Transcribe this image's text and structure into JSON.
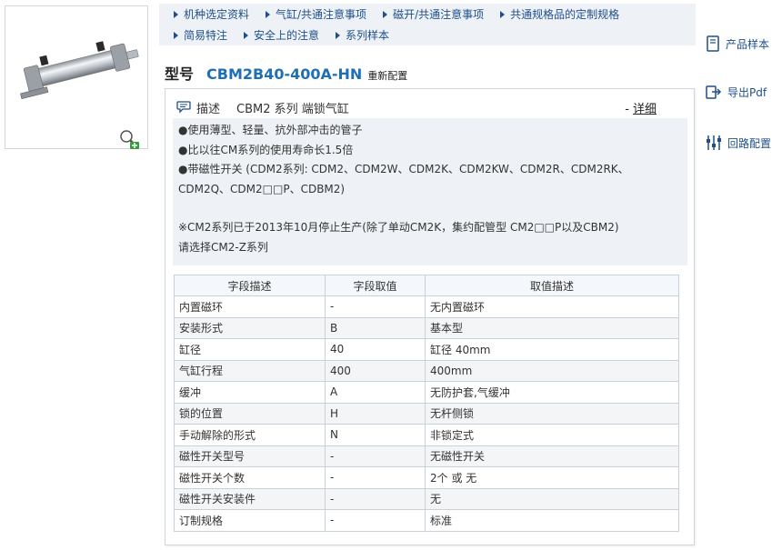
{
  "nav": {
    "row1": [
      "机种选定资料",
      "气缸/共通注意事项",
      "磁开/共通注意事项",
      "共通规格品的定制规格"
    ],
    "row2": [
      "简易特注",
      "安全上的注意",
      "系列样本"
    ]
  },
  "model": {
    "label": "型号",
    "code": "CBM2B40-400A-HN",
    "reconfigure": "重新配置"
  },
  "side": {
    "catalog": "产品样本",
    "export_pdf": "导出Pdf",
    "circuit": "回路配置"
  },
  "description": {
    "label": "描述",
    "title": "CBM2 系列 端锁气缸",
    "detail_prefix": "-",
    "detail": "详细",
    "lines": [
      "●使用薄型、轻量、抗外部冲击的管子",
      "●比以往CM系列的使用寿命长1.5倍",
      "●带磁性开关 (CDM2系列: CDM2、CDM2W、CDM2K、CDM2KW、CDM2R、CDM2RK、",
      "CDM2Q、CDM2□□P、CDBM2)",
      "※CM2系列已于2013年10月停止生产(除了单动CM2K，集约配管型 CM2□□P以及CBM2)",
      "请选择CM2-Z系列"
    ]
  },
  "table": {
    "headers": [
      "字段描述",
      "字段取值",
      "取值描述"
    ],
    "rows": [
      [
        "内置磁环",
        "-",
        "无内置磁环"
      ],
      [
        "安装形式",
        "B",
        "基本型"
      ],
      [
        "缸径",
        "40",
        "缸径 40mm"
      ],
      [
        "气缸行程",
        "400",
        "400mm"
      ],
      [
        "缓冲",
        "A",
        "无防护套,气缓冲"
      ],
      [
        "锁的位置",
        "H",
        "无杆侧锁"
      ],
      [
        "手动解除的形式",
        "N",
        "非锁定式"
      ],
      [
        "磁性开关型号",
        "-",
        "无磁性开关"
      ],
      [
        "磁性开关个数",
        "-",
        "2个 或 无"
      ],
      [
        "磁性开关安装件",
        "-",
        "无"
      ],
      [
        "订制规格",
        "-",
        "标准"
      ]
    ]
  },
  "icons": {
    "nav_bullet": "triangle-right-icon",
    "zoom": "zoom-in-icon",
    "catalog": "book-icon",
    "export": "export-icon",
    "circuit": "circuit-icon",
    "description": "speech-bubble-icon"
  },
  "colors": {
    "link": "#1f4f8b",
    "model_code": "#1f6fb5",
    "panel_bg": "#eef2f6"
  }
}
